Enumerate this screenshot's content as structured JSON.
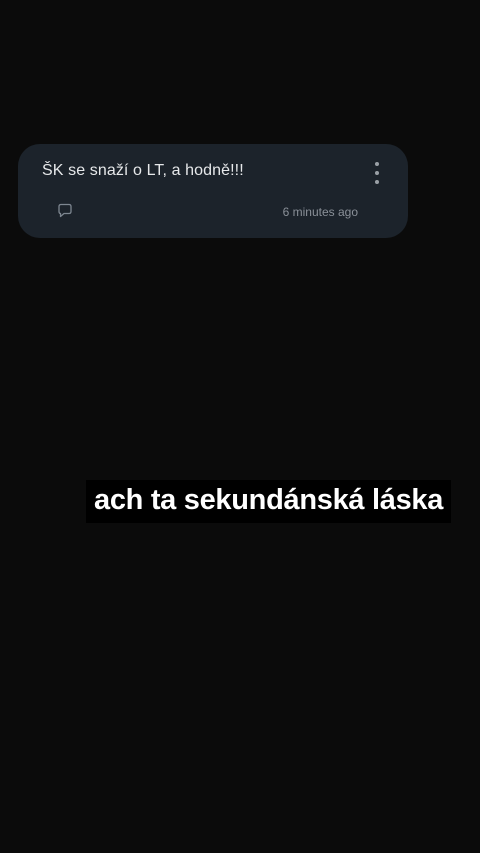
{
  "comment_card": {
    "message": "ŠK se snaží o LT, a hodně!!!",
    "timestamp": "6 minutes ago",
    "comment_icon": "speech-bubble-icon",
    "more_icon": "vertical-dots-icon"
  },
  "overlay": {
    "caption": "ach ta sekundánská láska"
  },
  "colors": {
    "background": "#0b0b0b",
    "card": "#1c232b",
    "message_text": "#e6e8ea",
    "muted_text": "#8a9098",
    "caption_bg": "#000000",
    "caption_text": "#ffffff"
  }
}
